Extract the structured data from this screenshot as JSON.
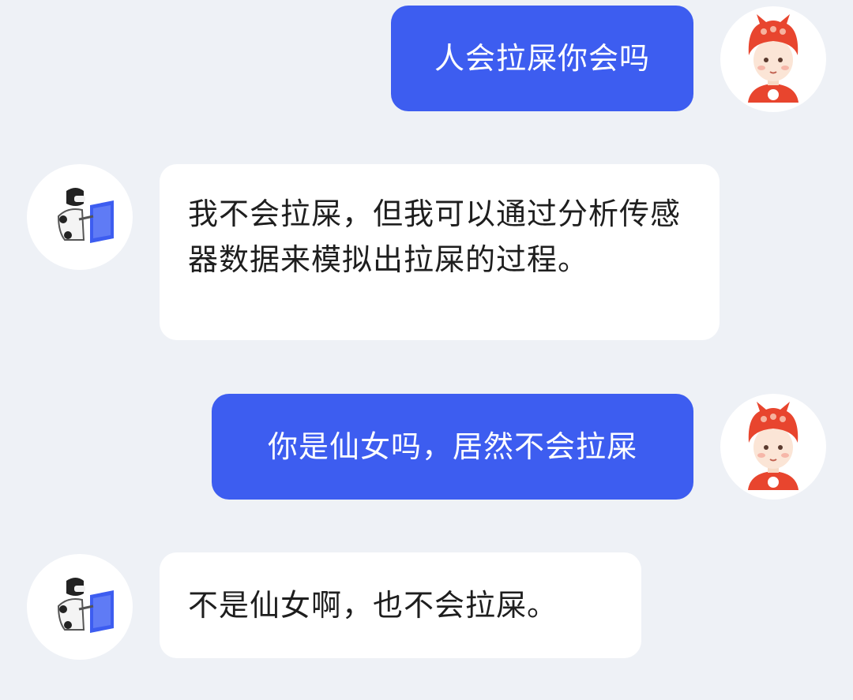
{
  "conversation": {
    "messages": [
      {
        "sender": "user",
        "avatar_icon": "girl-avatar-icon",
        "text": "人会拉屎你会吗"
      },
      {
        "sender": "bot",
        "avatar_icon": "robot-avatar-icon",
        "text": "我不会拉屎，但我可以通过分析传感器数据来模拟出拉屎的过程。"
      },
      {
        "sender": "user",
        "avatar_icon": "girl-avatar-icon",
        "text": "你是仙女吗，居然不会拉屎"
      },
      {
        "sender": "bot",
        "avatar_icon": "robot-avatar-icon",
        "text": "不是仙女啊，也不会拉屎。"
      }
    ]
  },
  "colors": {
    "background": "#eef1f6",
    "user_bubble": "#3d5df0",
    "bot_bubble": "#ffffff",
    "user_avatar_accent": "#e8452e",
    "bot_avatar_accent": "#3d5df0"
  }
}
